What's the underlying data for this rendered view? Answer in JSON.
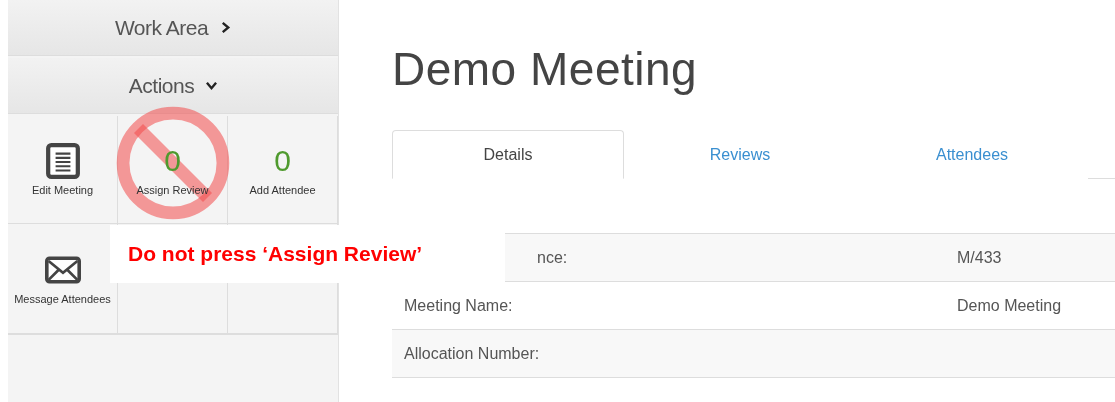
{
  "sidebar": {
    "sections": [
      {
        "label": "Work Area",
        "kind": "link"
      },
      {
        "label": "Actions",
        "kind": "dropdown"
      }
    ],
    "actions": [
      {
        "label": "Edit Meeting",
        "kind": "document"
      },
      {
        "label": "Assign Review",
        "kind": "count",
        "count": "0",
        "blocked": true
      },
      {
        "label": "Add Attendee",
        "kind": "count",
        "count": "0",
        "blocked": false
      },
      {
        "label": "Message Attendees",
        "kind": "envelope"
      },
      {
        "kind": "empty"
      },
      {
        "kind": "empty"
      }
    ]
  },
  "title": "Demo Meeting",
  "tabs": [
    {
      "label": "Details",
      "selected": true
    },
    {
      "label": "Reviews",
      "selected": false
    },
    {
      "label": "Attendees",
      "selected": false
    }
  ],
  "details": [
    {
      "label": "nce:",
      "value": "M/433",
      "covered": true
    },
    {
      "label": "Meeting Name:",
      "value": "Demo Meeting",
      "covered": false
    },
    {
      "label": "Allocation Number:",
      "covered": false
    }
  ],
  "annotation": {
    "text": "Do not press ‘Assign Review’"
  }
}
